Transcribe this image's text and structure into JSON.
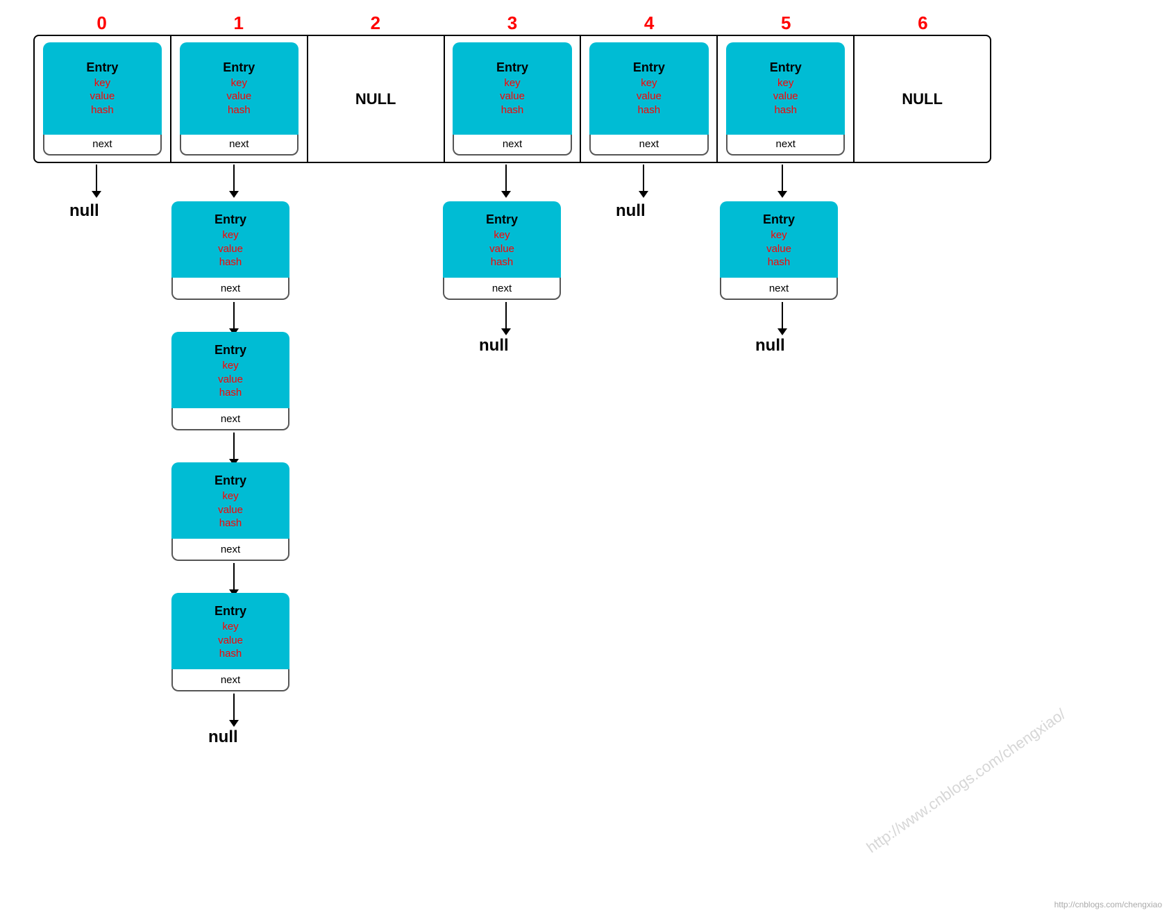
{
  "indices": [
    "0",
    "1",
    "2",
    "3",
    "4",
    "5",
    "6"
  ],
  "colors": {
    "teal": "#00bcd4",
    "red": "#ff0000",
    "index_color": "#ff0000"
  },
  "entry": {
    "title": "Entry",
    "fields": [
      "key",
      "value",
      "hash"
    ],
    "next_label": "next"
  },
  "null_label": "null",
  "null_text": "NULL",
  "watermark": "http://www.cnblogs.com/chengxiao/",
  "footer": "http://cnblogs.com/chengxiao"
}
